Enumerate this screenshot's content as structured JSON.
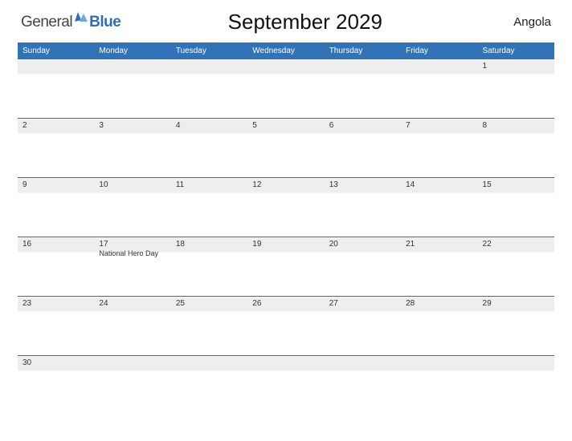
{
  "logo": {
    "part1": "General",
    "part2": "Blue"
  },
  "title": "September 2029",
  "country": "Angola",
  "day_headers": [
    "Sunday",
    "Monday",
    "Tuesday",
    "Wednesday",
    "Thursday",
    "Friday",
    "Saturday"
  ],
  "weeks": [
    [
      {
        "num": "",
        "event": ""
      },
      {
        "num": "",
        "event": ""
      },
      {
        "num": "",
        "event": ""
      },
      {
        "num": "",
        "event": ""
      },
      {
        "num": "",
        "event": ""
      },
      {
        "num": "",
        "event": ""
      },
      {
        "num": "1",
        "event": ""
      }
    ],
    [
      {
        "num": "2",
        "event": ""
      },
      {
        "num": "3",
        "event": ""
      },
      {
        "num": "4",
        "event": ""
      },
      {
        "num": "5",
        "event": ""
      },
      {
        "num": "6",
        "event": ""
      },
      {
        "num": "7",
        "event": ""
      },
      {
        "num": "8",
        "event": ""
      }
    ],
    [
      {
        "num": "9",
        "event": ""
      },
      {
        "num": "10",
        "event": ""
      },
      {
        "num": "11",
        "event": ""
      },
      {
        "num": "12",
        "event": ""
      },
      {
        "num": "13",
        "event": ""
      },
      {
        "num": "14",
        "event": ""
      },
      {
        "num": "15",
        "event": ""
      }
    ],
    [
      {
        "num": "16",
        "event": ""
      },
      {
        "num": "17",
        "event": "National Hero Day"
      },
      {
        "num": "18",
        "event": ""
      },
      {
        "num": "19",
        "event": ""
      },
      {
        "num": "20",
        "event": ""
      },
      {
        "num": "21",
        "event": ""
      },
      {
        "num": "22",
        "event": ""
      }
    ],
    [
      {
        "num": "23",
        "event": ""
      },
      {
        "num": "24",
        "event": ""
      },
      {
        "num": "25",
        "event": ""
      },
      {
        "num": "26",
        "event": ""
      },
      {
        "num": "27",
        "event": ""
      },
      {
        "num": "28",
        "event": ""
      },
      {
        "num": "29",
        "event": ""
      }
    ],
    [
      {
        "num": "30",
        "event": ""
      },
      {
        "num": "",
        "event": ""
      },
      {
        "num": "",
        "event": ""
      },
      {
        "num": "",
        "event": ""
      },
      {
        "num": "",
        "event": ""
      },
      {
        "num": "",
        "event": ""
      },
      {
        "num": "",
        "event": ""
      }
    ]
  ]
}
